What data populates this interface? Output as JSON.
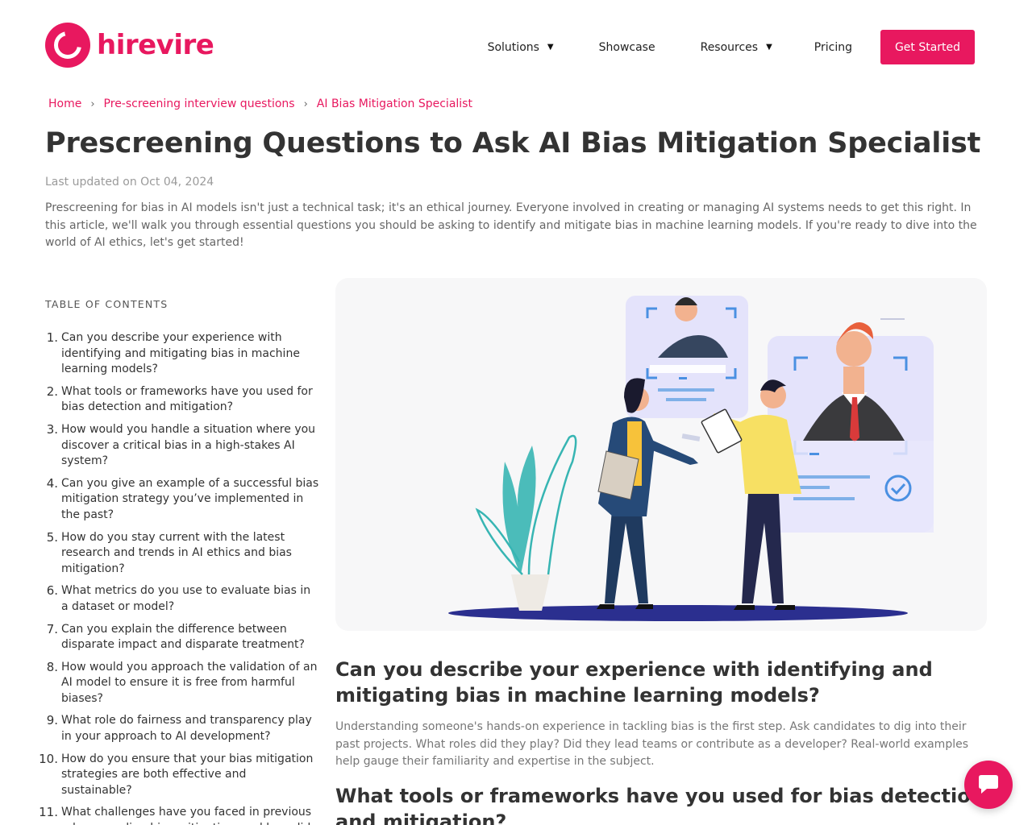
{
  "brand": {
    "name": "hirevire",
    "accent": "#e8185f"
  },
  "nav": {
    "solutions": "Solutions",
    "showcase": "Showcase",
    "resources": "Resources",
    "pricing": "Pricing",
    "cta": "Get Started"
  },
  "breadcrumb": [
    "Home",
    "Pre-screening interview questions",
    "AI Bias Mitigation Specialist"
  ],
  "page": {
    "title": "Prescreening Questions to Ask AI Bias Mitigation Specialist",
    "updated": "Last updated on Oct 04, 2024",
    "intro": "Prescreening for bias in AI models isn't just a technical task; it's an ethical journey. Everyone involved in creating or managing AI systems needs to get this right. In this article, we'll walk you through essential questions you should be asking to identify and mitigate bias in machine learning models. If you're ready to dive into the world of AI ethics, let's get started!"
  },
  "toc": {
    "heading": "TABLE OF CONTENTS",
    "items": [
      {
        "num": "1.",
        "text": "Can you describe your experience with identifying and mitigating bias in machine learning models?"
      },
      {
        "num": "2.",
        "text": "What tools or frameworks have you used for bias detection and mitigation?"
      },
      {
        "num": "3.",
        "text": "How would you handle a situation where you discover a critical bias in a high-stakes AI system?"
      },
      {
        "num": "4.",
        "text": "Can you give an example of a successful bias mitigation strategy you’ve implemented in the past?"
      },
      {
        "num": "5.",
        "text": "How do you stay current with the latest research and trends in AI ethics and bias mitigation?"
      },
      {
        "num": "6.",
        "text": "What metrics do you use to evaluate bias in a dataset or model?"
      },
      {
        "num": "7.",
        "text": "Can you explain the difference between disparate impact and disparate treatment?"
      },
      {
        "num": "8.",
        "text": "How would you approach the validation of an AI model to ensure it is free from harmful biases?"
      },
      {
        "num": "9.",
        "text": "What role do fairness and transparency play in your approach to AI development?"
      },
      {
        "num": "10.",
        "text": "How do you ensure that your bias mitigation strategies are both effective and sustainable?"
      },
      {
        "num": "11.",
        "text": "What challenges have you faced in previous roles regarding bias mitigation, and how did you overcome them?"
      }
    ]
  },
  "content": {
    "q1_title": "Can you describe your experience with identifying and mitigating bias in machine learning models?",
    "q1_body": "Understanding someone's hands-on experience in tackling bias is the first step. Ask candidates to dig into their past projects. What roles did they play? Did they lead teams or contribute as a developer? Real-world examples help gauge their familiarity and expertise in the subject.",
    "q2_title": "What tools or frameworks have you used for bias detection and mitigation?"
  },
  "icons": {
    "caret": "▼",
    "breadcrumb_sep": "›",
    "chat": "chat-icon"
  }
}
